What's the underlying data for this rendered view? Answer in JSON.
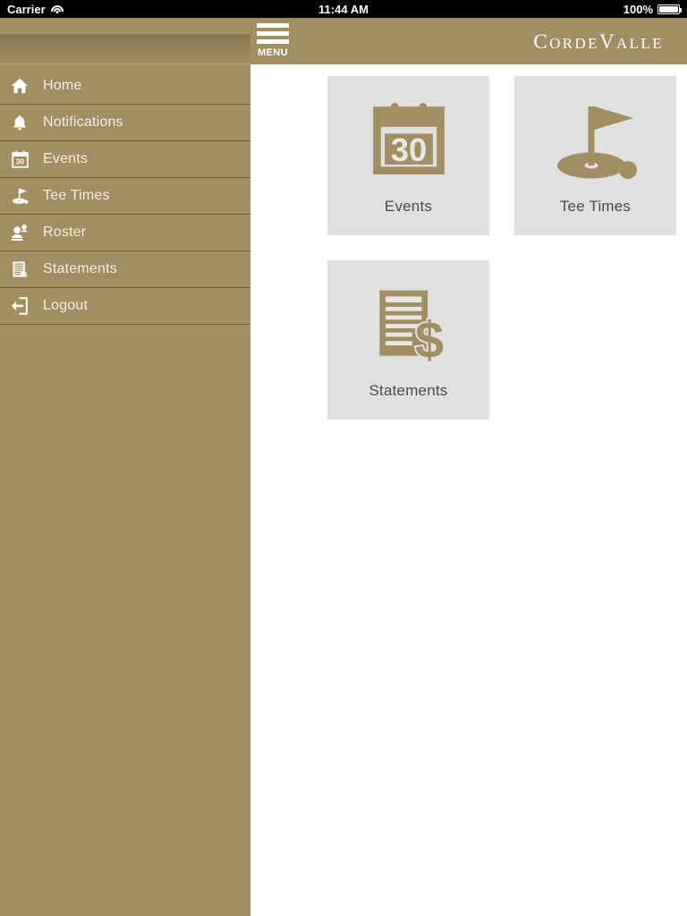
{
  "status_bar": {
    "carrier": "Carrier",
    "wifi_icon": "wifi-icon",
    "time": "11:44 AM",
    "battery_percent": "100%",
    "battery_icon": "battery-full-icon"
  },
  "header": {
    "menu_button_label": "MENU",
    "menu_icon": "hamburger-icon",
    "brand": {
      "full": "CORDEVALLE",
      "part1_big": "C",
      "part1_rest": "ORDE",
      "part2_big": "V",
      "part2_rest": "ALLE"
    },
    "background_color": "#a08f63"
  },
  "sidebar": {
    "background_color": "#a08f63",
    "items": [
      {
        "label": "Home",
        "icon": "home-icon"
      },
      {
        "label": "Notifications",
        "icon": "bell-icon"
      },
      {
        "label": "Events",
        "icon": "calendar-icon"
      },
      {
        "label": "Tee Times",
        "icon": "golf-flag-icon"
      },
      {
        "label": "Roster",
        "icon": "people-icon"
      },
      {
        "label": "Statements",
        "icon": "document-dollar-icon"
      },
      {
        "label": "Logout",
        "icon": "logout-arrow-icon"
      }
    ]
  },
  "main": {
    "background_color": "#ffffff",
    "tile_background_color": "#e0e0e0",
    "tile_icon_color": "#a08f63",
    "tile_label_color": "#4c4c4c",
    "tiles": [
      {
        "label": "Events",
        "icon": "calendar-30-icon",
        "day_number": "30"
      },
      {
        "label": "Tee Times",
        "icon": "golf-flag-green-icon"
      },
      {
        "label": "Statements",
        "icon": "statement-dollar-icon"
      }
    ]
  }
}
